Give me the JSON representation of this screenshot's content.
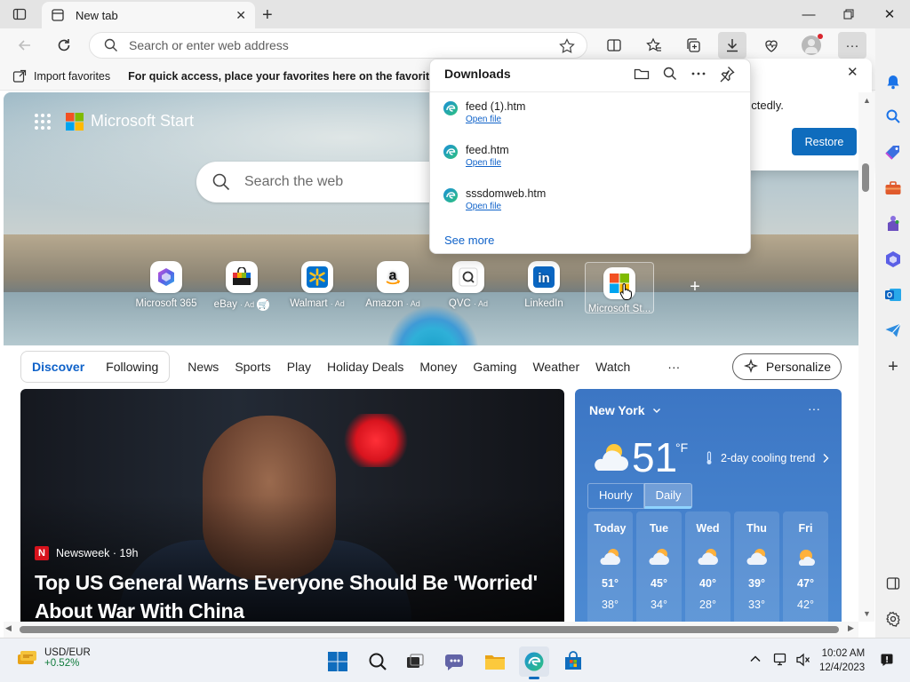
{
  "browser": {
    "tab_title": "New tab",
    "address_placeholder": "Search or enter web address"
  },
  "favorites_bar": {
    "import_label": "Import favorites",
    "hint": "For quick access, place your favorites here on the favorites bar."
  },
  "downloads": {
    "title": "Downloads",
    "items": [
      {
        "name": "feed (1).htm",
        "action": "Open file"
      },
      {
        "name": "feed.htm",
        "action": "Open file"
      },
      {
        "name": "sssdomweb.htm",
        "action": "Open file"
      }
    ],
    "see_more": "See more"
  },
  "restore_panel": {
    "message": "ectedly.",
    "button": "Restore"
  },
  "start_page": {
    "brand": "Microsoft Start",
    "search_placeholder": "Search the web",
    "quick_links": [
      {
        "label": "Microsoft 365",
        "ad": ""
      },
      {
        "label": "eBay",
        "ad": "· Ad"
      },
      {
        "label": "Walmart",
        "ad": "· Ad"
      },
      {
        "label": "Amazon",
        "ad": "· Ad"
      },
      {
        "label": "QVC",
        "ad": "· Ad"
      },
      {
        "label": "LinkedIn",
        "ad": ""
      },
      {
        "label": "Microsoft St...",
        "ad": ""
      }
    ],
    "add_site": "+"
  },
  "feed_nav": {
    "discover": "Discover",
    "following": "Following",
    "items": [
      "News",
      "Sports",
      "Play",
      "Holiday Deals",
      "Money",
      "Gaming",
      "Weather",
      "Watch"
    ],
    "more": "···",
    "personalize": "Personalize"
  },
  "news_card": {
    "source": "Newsweek · 19h",
    "source_badge": "N",
    "headline": "Top US General Warns Everyone Should Be 'Worried' About War With China"
  },
  "weather": {
    "location": "New York",
    "temperature": "51",
    "unit": "°F",
    "trend": "2-day cooling trend",
    "tabs": [
      "Hourly",
      "Daily"
    ],
    "forecast": [
      {
        "day": "Today",
        "high": "51°",
        "low": "38°"
      },
      {
        "day": "Tue",
        "high": "45°",
        "low": "34°"
      },
      {
        "day": "Wed",
        "high": "40°",
        "low": "28°"
      },
      {
        "day": "Thu",
        "high": "39°",
        "low": "33°"
      },
      {
        "day": "Fri",
        "high": "47°",
        "low": "42°"
      }
    ]
  },
  "taskbar": {
    "fx_pair": "USD/EUR",
    "fx_change": "+0.52%",
    "time": "10:02 AM",
    "date": "12/4/2023"
  },
  "colors": {
    "accent": "#0f6cbd",
    "link": "#0f62c9",
    "weather_bg": "#3c76c4"
  }
}
